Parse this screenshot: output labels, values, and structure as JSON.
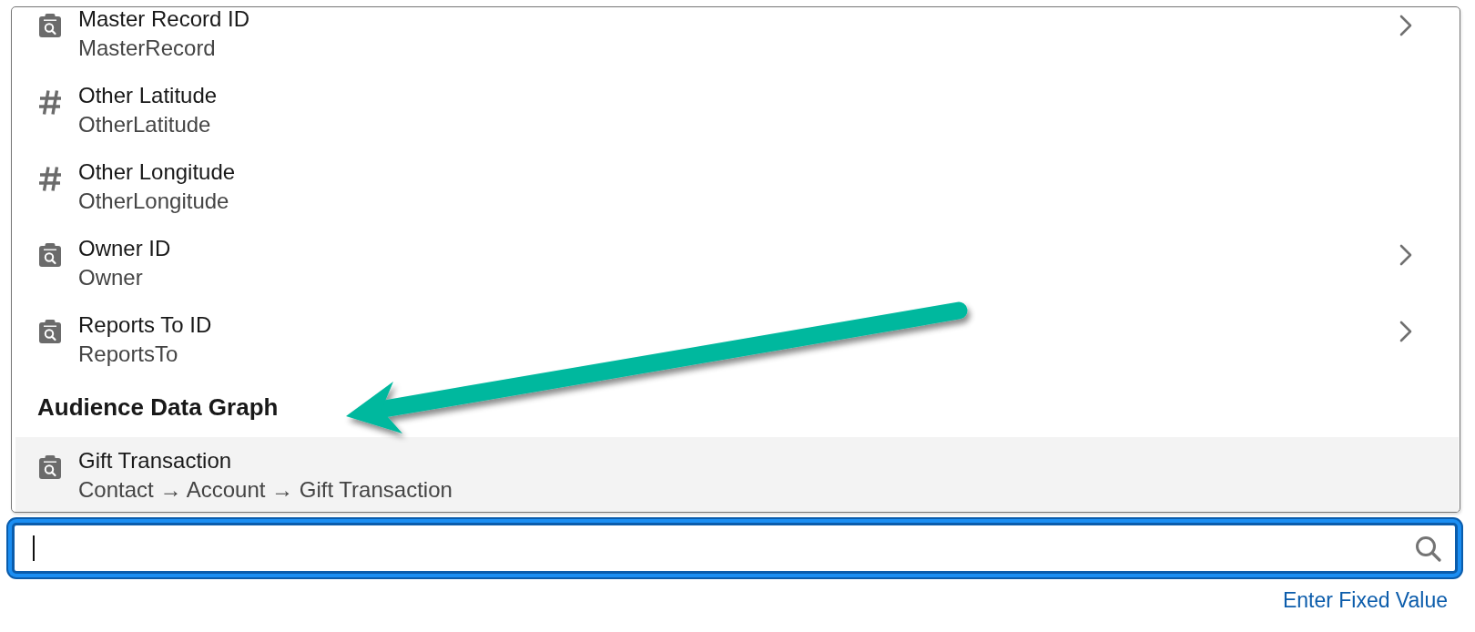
{
  "dropdown": {
    "sections": [
      {
        "items": [
          {
            "kind": "lookup",
            "label": "Master Record ID",
            "subtitle": "MasterRecord",
            "has_submenu": true,
            "selected": false
          },
          {
            "kind": "number",
            "label": "Other Latitude",
            "subtitle": "OtherLatitude",
            "has_submenu": false,
            "selected": false
          },
          {
            "kind": "number",
            "label": "Other Longitude",
            "subtitle": "OtherLongitude",
            "has_submenu": false,
            "selected": false
          },
          {
            "kind": "lookup",
            "label": "Owner ID",
            "subtitle": "Owner",
            "has_submenu": true,
            "selected": false
          },
          {
            "kind": "lookup",
            "label": "Reports To ID",
            "subtitle": "ReportsTo",
            "has_submenu": true,
            "selected": false
          }
        ]
      },
      {
        "heading": "Audience Data Graph",
        "items": [
          {
            "kind": "lookup",
            "label": "Gift Transaction",
            "subtitle": "Contact → Account → Gift Transaction",
            "has_submenu": false,
            "selected": true
          }
        ]
      }
    ]
  },
  "search": {
    "focused": true
  },
  "link": "Enter Fixed Value"
}
